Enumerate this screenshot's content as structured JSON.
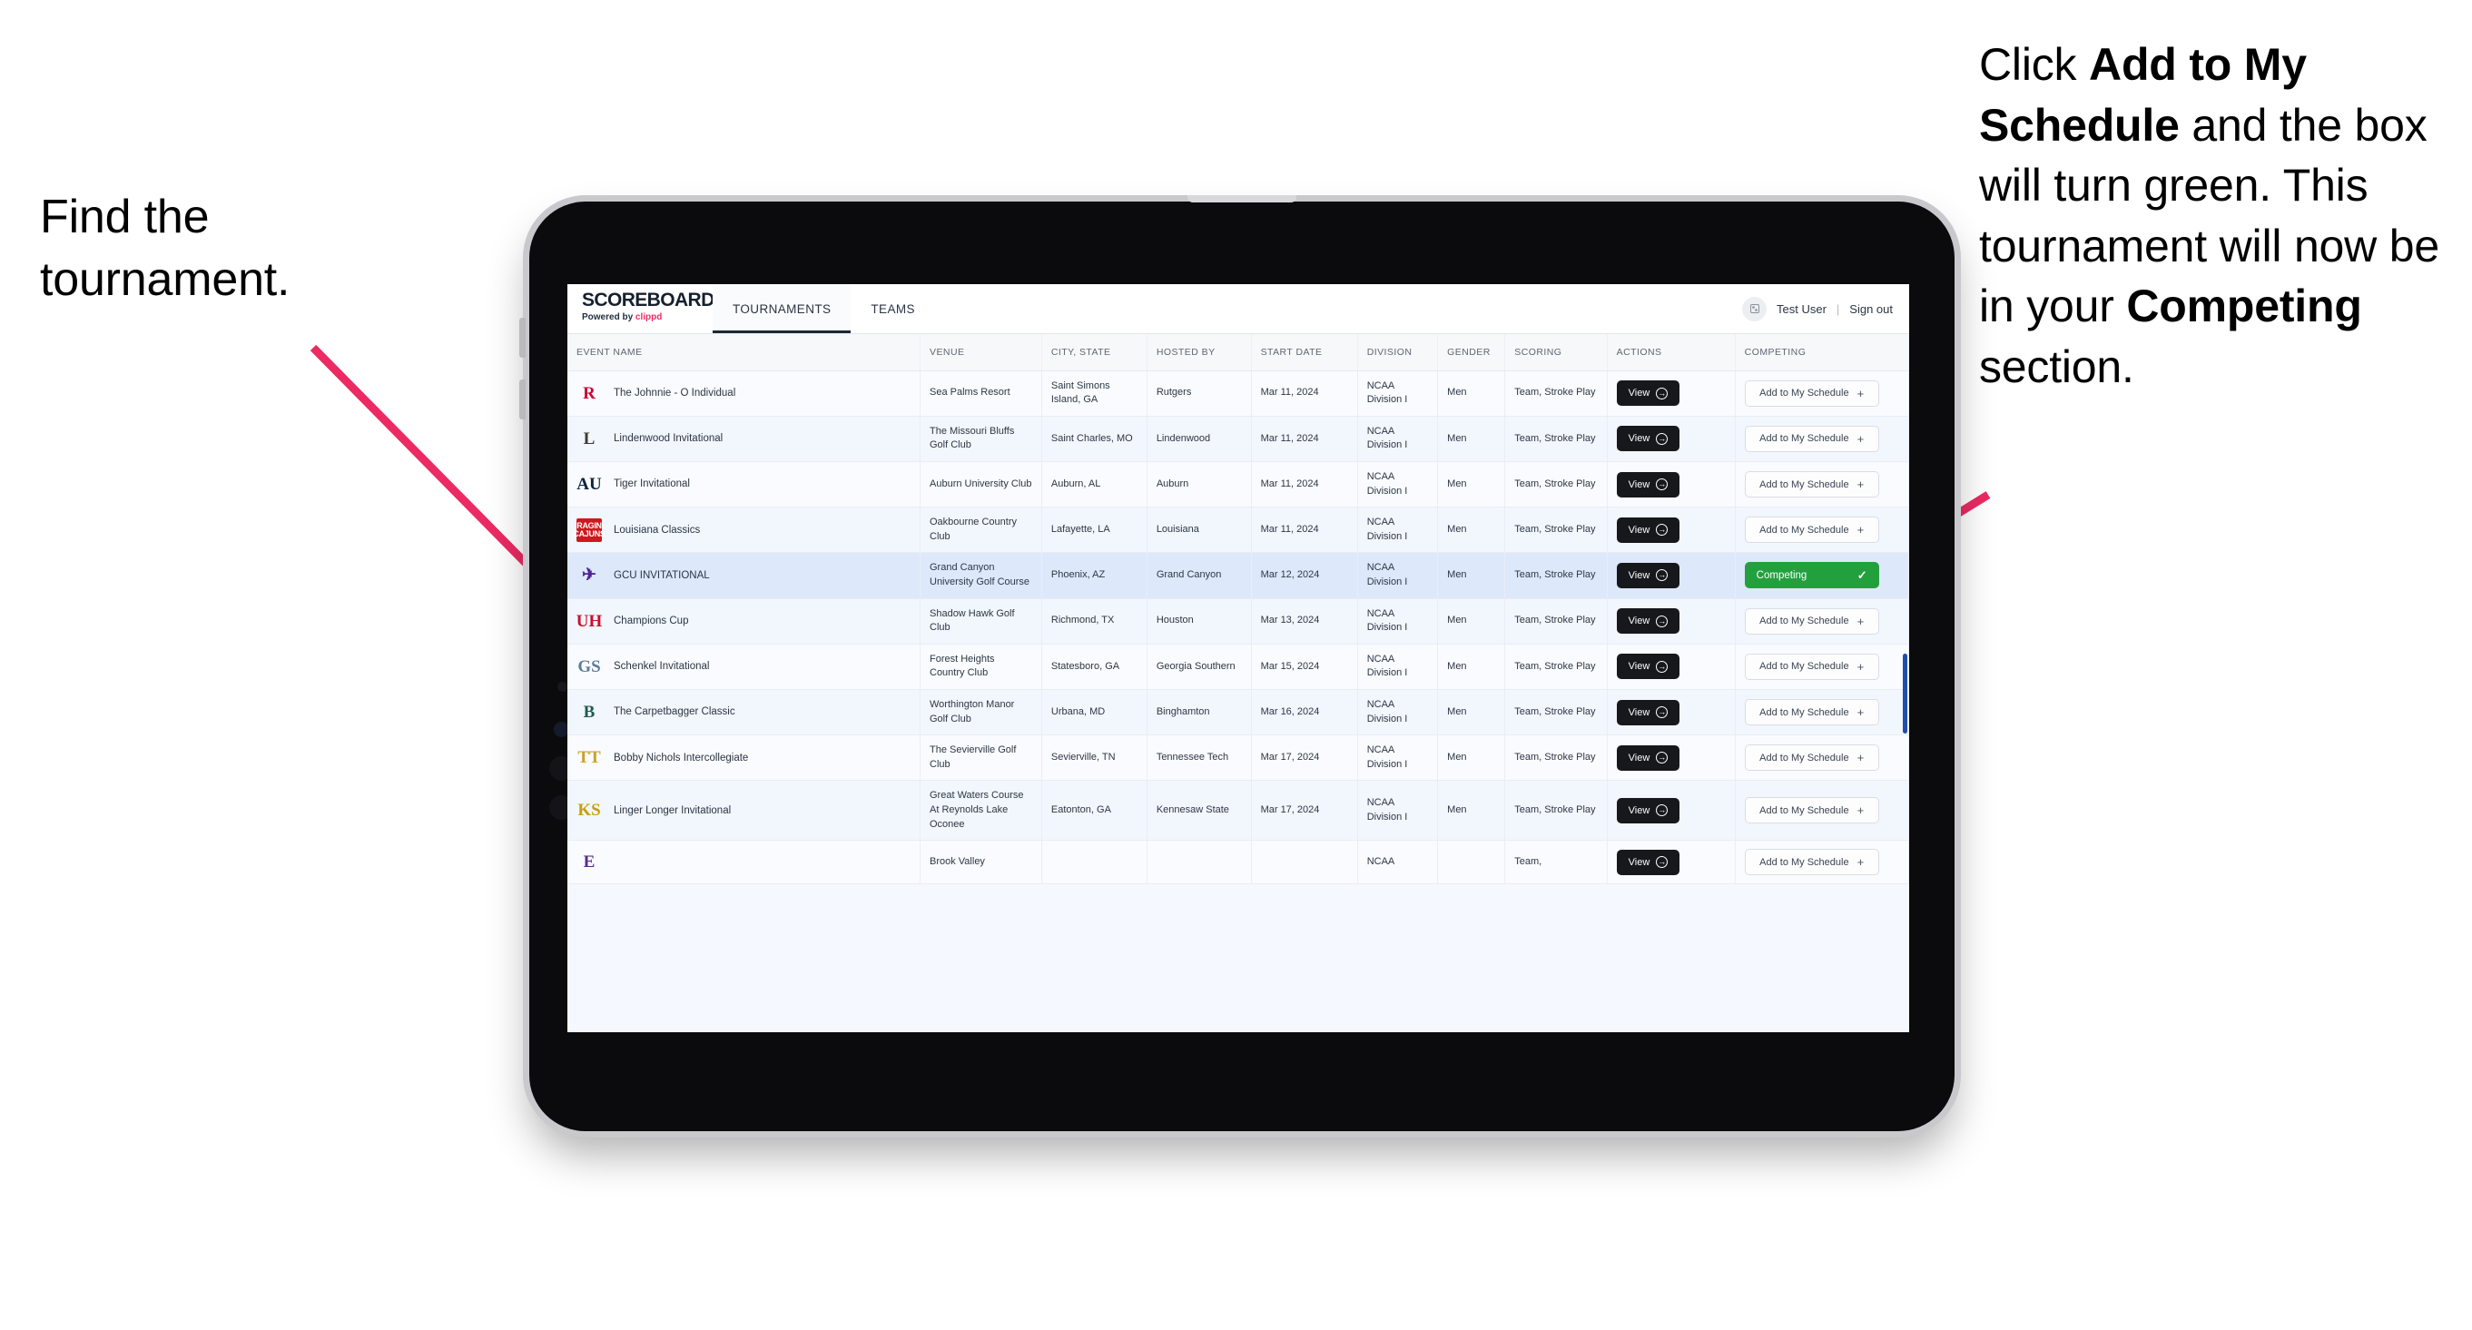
{
  "annotations": {
    "left": "Find the tournament.",
    "right_parts": [
      {
        "t": "Click ",
        "b": false
      },
      {
        "t": "Add to My Schedule",
        "b": true
      },
      {
        "t": " and the box will turn green. This tournament will now be in your ",
        "b": false
      },
      {
        "t": "Competing",
        "b": true
      },
      {
        "t": " section.",
        "b": false
      }
    ],
    "arrow_color": "#ec2a63"
  },
  "app": {
    "brand": {
      "title": "SCOREBOARD",
      "powered_prefix": "Powered by ",
      "powered_brand": "clippd"
    },
    "nav": [
      {
        "label": "TOURNAMENTS",
        "active": true
      },
      {
        "label": "TEAMS",
        "active": false
      }
    ],
    "header_right": {
      "avatar_icon": "user-avatar-icon",
      "user": "Test User",
      "separator": "|",
      "signout": "Sign out"
    },
    "columns": [
      "EVENT NAME",
      "VENUE",
      "CITY, STATE",
      "HOSTED BY",
      "START DATE",
      "DIVISION",
      "GENDER",
      "SCORING",
      "ACTIONS",
      "COMPETING"
    ],
    "buttons": {
      "view": "View",
      "view_icon": "arrow-right-circle-icon",
      "add": "Add to My Schedule",
      "add_icon": "plus-icon",
      "competing": "Competing",
      "competing_icon": "check-icon"
    },
    "rows": [
      {
        "logo": {
          "text": "R",
          "color": "#cc0033",
          "bg": "transparent",
          "kind": "letter"
        },
        "event": "The Johnnie - O Individual",
        "venue": "Sea Palms Resort",
        "city": "Saint Simons Island, GA",
        "host": "Rutgers",
        "date": "Mar 11, 2024",
        "division": "NCAA Division I",
        "gender": "Men",
        "scoring": "Team, Stroke Play",
        "competing": false
      },
      {
        "logo": {
          "text": "L",
          "color": "#3b3b2f",
          "bg": "transparent",
          "kind": "letter"
        },
        "event": "Lindenwood Invitational",
        "venue": "The Missouri Bluffs Golf Club",
        "city": "Saint Charles, MO",
        "host": "Lindenwood",
        "date": "Mar 11, 2024",
        "division": "NCAA Division I",
        "gender": "Men",
        "scoring": "Team, Stroke Play",
        "competing": false
      },
      {
        "logo": {
          "text": "AU",
          "color": "#0c2340",
          "bg": "transparent",
          "kind": "letter"
        },
        "event": "Tiger Invitational",
        "venue": "Auburn University Club",
        "city": "Auburn, AL",
        "host": "Auburn",
        "date": "Mar 11, 2024",
        "division": "NCAA Division I",
        "gender": "Men",
        "scoring": "Team, Stroke Play",
        "competing": false
      },
      {
        "logo": {
          "text": "RAGIN CAJUNS",
          "color": "#ffffff",
          "bg": "#ce181e",
          "kind": "box"
        },
        "event": "Louisiana Classics",
        "venue": "Oakbourne Country Club",
        "city": "Lafayette, LA",
        "host": "Louisiana",
        "date": "Mar 11, 2024",
        "division": "NCAA Division I",
        "gender": "Men",
        "scoring": "Team, Stroke Play",
        "competing": false
      },
      {
        "logo": {
          "text": "✈",
          "color": "#522398",
          "bg": "transparent",
          "kind": "glyph"
        },
        "event": "GCU INVITATIONAL",
        "venue": "Grand Canyon University Golf Course",
        "city": "Phoenix, AZ",
        "host": "Grand Canyon",
        "date": "Mar 12, 2024",
        "division": "NCAA Division I",
        "gender": "Men",
        "scoring": "Team, Stroke Play",
        "competing": true
      },
      {
        "logo": {
          "text": "UH",
          "color": "#c8102e",
          "bg": "transparent",
          "kind": "letter"
        },
        "event": "Champions Cup",
        "venue": "Shadow Hawk Golf Club",
        "city": "Richmond, TX",
        "host": "Houston",
        "date": "Mar 13, 2024",
        "division": "NCAA Division I",
        "gender": "Men",
        "scoring": "Team, Stroke Play",
        "competing": false
      },
      {
        "logo": {
          "text": "GS",
          "color": "#5c7c99",
          "bg": "transparent",
          "kind": "letter"
        },
        "event": "Schenkel Invitational",
        "venue": "Forest Heights Country Club",
        "city": "Statesboro, GA",
        "host": "Georgia Southern",
        "date": "Mar 15, 2024",
        "division": "NCAA Division I",
        "gender": "Men",
        "scoring": "Team, Stroke Play",
        "competing": false
      },
      {
        "logo": {
          "text": "B",
          "color": "#1e5c4f",
          "bg": "transparent",
          "kind": "letter"
        },
        "event": "The Carpetbagger Classic",
        "venue": "Worthington Manor Golf Club",
        "city": "Urbana, MD",
        "host": "Binghamton",
        "date": "Mar 16, 2024",
        "division": "NCAA Division I",
        "gender": "Men",
        "scoring": "Team, Stroke Play",
        "competing": false
      },
      {
        "logo": {
          "text": "TT",
          "color": "#c9a227",
          "bg": "transparent",
          "kind": "letter"
        },
        "event": "Bobby Nichols Intercollegiate",
        "venue": "The Sevierville Golf Club",
        "city": "Sevierville, TN",
        "host": "Tennessee Tech",
        "date": "Mar 17, 2024",
        "division": "NCAA Division I",
        "gender": "Men",
        "scoring": "Team, Stroke Play",
        "competing": false
      },
      {
        "logo": {
          "text": "KS",
          "color": "#c7a100",
          "bg": "transparent",
          "kind": "letter"
        },
        "event": "Linger Longer Invitational",
        "venue": "Great Waters Course At Reynolds Lake Oconee",
        "city": "Eatonton, GA",
        "host": "Kennesaw State",
        "date": "Mar 17, 2024",
        "division": "NCAA Division I",
        "gender": "Men",
        "scoring": "Team, Stroke Play",
        "competing": false
      },
      {
        "logo": {
          "text": "E",
          "color": "#592a8a",
          "bg": "transparent",
          "kind": "letter"
        },
        "event": "",
        "venue": "Brook Valley",
        "city": "",
        "host": "",
        "date": "",
        "division": "NCAA",
        "gender": "",
        "scoring": "Team,",
        "competing": false,
        "cut": true
      }
    ]
  }
}
